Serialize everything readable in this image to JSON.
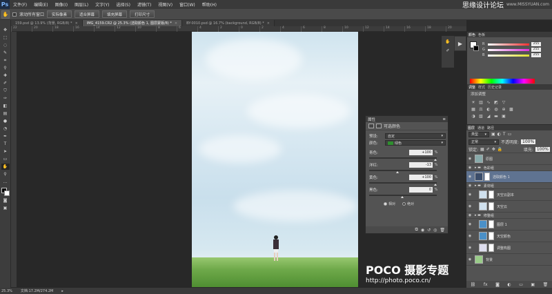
{
  "menubar": {
    "logo": "Ps",
    "items": [
      "文件(F)",
      "编辑(E)",
      "图像(I)",
      "图层(L)",
      "文字(Y)",
      "选择(S)",
      "滤镜(T)",
      "视图(V)",
      "窗口(W)",
      "帮助(H)"
    ],
    "brand": "思缘设计论坛",
    "brand_url": "www.MISSYUAN.com"
  },
  "options": {
    "checkbox_label": "滚动所有窗口",
    "buttons": [
      "实际像素",
      "适合屏幕",
      "填充屏幕",
      "打印尺寸"
    ]
  },
  "tabs": [
    {
      "label": "159.psd @ 13.9% (背景, RGB/8) *",
      "active": false
    },
    {
      "label": "IMG_4159.CR2 @ 25.3% (选取颜色 1, 图层蒙版/8) *",
      "active": true
    },
    {
      "label": "BY-0010.psd @ 16.7% (background, RGB/8) *",
      "active": false
    }
  ],
  "ruler_ticks": [
    "22",
    "20",
    "18",
    "16",
    "14",
    "12",
    "10",
    "8",
    "6",
    "4",
    "2",
    "0",
    "2",
    "4",
    "6",
    "8",
    "10",
    "12",
    "14",
    "16",
    "18",
    "20"
  ],
  "properties": {
    "tab": "属性",
    "title": "可选颜色",
    "preset_label": "预设:",
    "preset_value": "自定",
    "colors_label": "颜色:",
    "colors_value": "绿色",
    "sliders": [
      {
        "label": "青色:",
        "value": "+100",
        "unit": "%",
        "pos": 1.0
      },
      {
        "label": "洋红:",
        "value": "-13",
        "unit": "%",
        "pos": 0.43
      },
      {
        "label": "黄色:",
        "value": "+100",
        "unit": "%",
        "pos": 1.0
      },
      {
        "label": "黑色:",
        "value": "0",
        "unit": "%",
        "pos": 0.5
      }
    ],
    "radio_relative": "相对",
    "radio_absolute": "绝对"
  },
  "color_panel": {
    "tabs": [
      "颜色",
      "色板"
    ],
    "rows": [
      {
        "label": "R",
        "value": "255",
        "color": "#ff4040"
      },
      {
        "label": "G",
        "value": "255",
        "color": "#e040e0"
      },
      {
        "label": "B",
        "value": "255",
        "color": "#e0e040"
      }
    ]
  },
  "adjust_panel": {
    "tabs": [
      "调整",
      "样式",
      "历史记录"
    ],
    "title": "添加调整"
  },
  "layers_panel": {
    "tabs": [
      "图层",
      "通道",
      "路径"
    ],
    "filter_label": "类型",
    "blend_mode": "正常",
    "opacity_label": "不透明度:",
    "opacity_value": "100%",
    "lock_label": "锁定:",
    "fill_label": "填充:",
    "fill_value": "100%",
    "layers": [
      {
        "name": "原图",
        "type": "layer",
        "selected": false,
        "thumb": "#8aa"
      },
      {
        "name": "色彩组",
        "type": "group",
        "selected": false
      },
      {
        "name": "选取颜色 1",
        "type": "adjust",
        "selected": true,
        "thumb": "#3b4d6a"
      },
      {
        "name": "素材组",
        "type": "group",
        "selected": false
      },
      {
        "name": "天空云副本",
        "type": "layer",
        "selected": false,
        "thumb": "#cfe0ee"
      },
      {
        "name": "天空云",
        "type": "layer",
        "selected": false,
        "thumb": "#cfe0ee"
      },
      {
        "name": "修整组",
        "type": "group",
        "selected": false
      },
      {
        "name": "图层 1",
        "type": "layer",
        "selected": false,
        "thumb": "#4a90c8"
      },
      {
        "name": "天空颜色",
        "type": "layer",
        "selected": false,
        "thumb": "#4a90c8"
      },
      {
        "name": "调整构图",
        "type": "layer",
        "selected": false,
        "thumb": "#dde"
      },
      {
        "name": "背景",
        "type": "layer",
        "selected": false,
        "thumb": "#9c8"
      }
    ]
  },
  "status": {
    "zoom": "25.3%",
    "doc": "文档:17.2M/274.2M"
  },
  "watermark": {
    "brand": "POCO 摄影专题",
    "url": "http://photo.poco.cn/"
  }
}
